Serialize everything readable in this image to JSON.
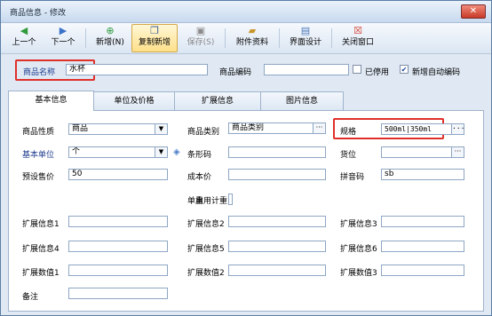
{
  "window": {
    "title": "商品信息 - 修改",
    "close_icon": "close-icon"
  },
  "toolbar": {
    "prev": "上一个",
    "next": "下一个",
    "new": "新增(N)",
    "copy_new": "复制新增",
    "save": "保存(S)",
    "attachments": "附件资料",
    "ui_design": "界面设计",
    "close": "关闭窗口"
  },
  "header": {
    "name_label": "商品名称",
    "name_value": "水杯",
    "code_label": "商品编码",
    "code_value": "",
    "disabled_label": "已停用",
    "disabled_checked": false,
    "auto_code_label": "新增自动编码",
    "auto_code_checked": true
  },
  "tabs": [
    "基本信息",
    "单位及价格",
    "扩展信息",
    "图片信息"
  ],
  "basic": {
    "nature_label": "商品性质",
    "nature_value": "商品",
    "category_label": "商品类别",
    "category_value": "商品类别",
    "spec_label": "规格",
    "spec_value": "500ml|350ml",
    "unit_label": "基本单位",
    "unit_value": "个",
    "barcode_label": "条形码",
    "barcode_value": "",
    "location_label": "货位",
    "location_value": "",
    "preset_price_label": "预设售价",
    "preset_price_value": "50",
    "cost_label": "成本价",
    "cost_value": "",
    "pinyin_label": "拼音码",
    "pinyin_value": "sb",
    "weight_label": "单重",
    "weight_overlap": "启用计重",
    "ext_info_labels": [
      "扩展信息1",
      "扩展信息2",
      "扩展信息3",
      "扩展信息4",
      "扩展信息5",
      "扩展信息6"
    ],
    "ext_num_labels": [
      "扩展数值1",
      "扩展数值2",
      "扩展数值3"
    ],
    "remark_label": "备注"
  },
  "accent": {
    "highlight": "#e0302a",
    "link_blue": "#1f3d8f"
  }
}
